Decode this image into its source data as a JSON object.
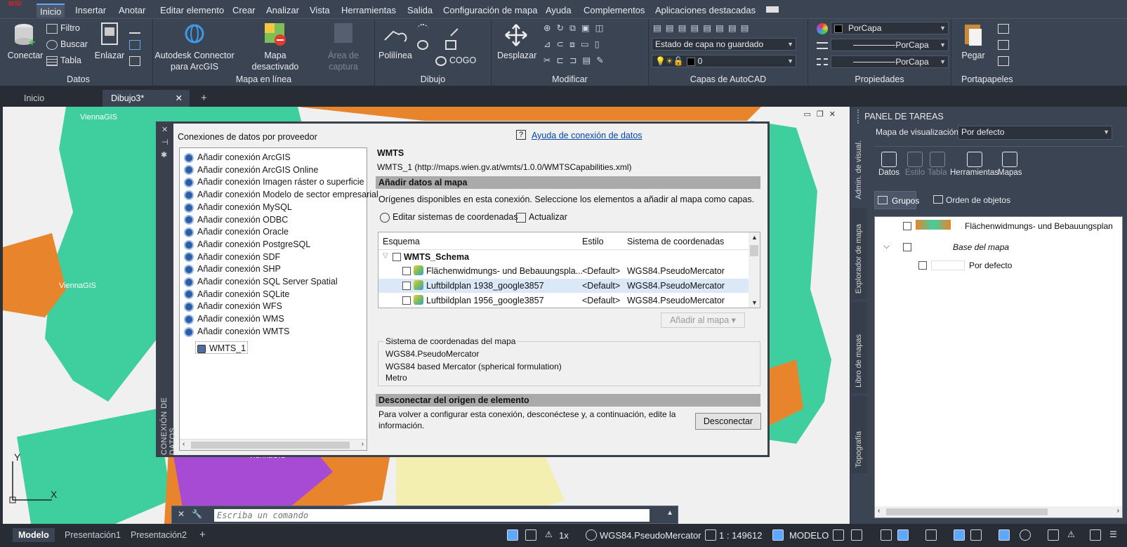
{
  "app": {
    "logo": "M3D"
  },
  "menu": [
    "Inicio",
    "Insertar",
    "Anotar",
    "Editar elemento",
    "Crear",
    "Analizar",
    "Vista",
    "Herramientas",
    "Salida",
    "Configuración de mapa",
    "Ayuda",
    "Complementos",
    "Aplicaciones destacadas"
  ],
  "ribbon": {
    "datos": {
      "title": "Datos",
      "conectar": "Conectar",
      "filtro": "Filtro",
      "buscar": "Buscar",
      "tabla": "Tabla"
    },
    "mapa_en_linea": {
      "title": "Mapa en línea",
      "enlazar": "Enlazar",
      "connector": "Autodesk Connector para ArcGIS",
      "connector_l1": "Autodesk Connector",
      "connector_l2": "para ArcGIS",
      "mapa_desactivado": "Mapa desactivado",
      "area_l1": "Área de",
      "area_l2": "captura"
    },
    "dibujo": {
      "title": "Dibujo",
      "polilinea": "Polilínea",
      "cogo": "COGO"
    },
    "modificar": {
      "title": "Modificar",
      "desplazar": "Desplazar"
    },
    "capas": {
      "title": "Capas de AutoCAD",
      "estado": "Estado de capa no guardado",
      "layer": "0"
    },
    "propiedades": {
      "title": "Propiedades",
      "color": "PorCapa",
      "linetype": "PorCapa",
      "lineweight": "PorCapa"
    },
    "portapapeles": {
      "title": "Portapapeles",
      "pegar": "Pegar"
    }
  },
  "tabs": {
    "inicio": "Inicio",
    "dibujo": "Dibujo3*",
    "add": "+"
  },
  "dialog": {
    "side_title": "CONEXIÓN DE DATOS",
    "providers_title": "Conexiones de datos por proveedor",
    "help_link": "Ayuda de conexión de datos",
    "providers": [
      "Añadir conexión ArcGIS",
      "Añadir conexión ArcGIS Online",
      "Añadir conexión Imagen ráster o superficie",
      "Añadir conexión Modelo de sector empresarial",
      "Añadir conexión MySQL",
      "Añadir conexión ODBC",
      "Añadir conexión Oracle",
      "Añadir conexión PostgreSQL",
      "Añadir conexión SDF",
      "Añadir conexión SHP",
      "Añadir conexión SQL Server Spatial",
      "Añadir conexión SQLite",
      "Añadir conexión WFS",
      "Añadir conexión WMS",
      "Añadir conexión WMTS"
    ],
    "child_connection": "WMTS_1",
    "conn_type": "WMTS",
    "conn_url": "WMTS_1 (http://maps.wien.gv.at/wmts/1.0.0/WMTSCapabilities.xml)",
    "add_data_header": "Añadir datos al mapa",
    "origins_text": "Orígenes disponibles en esta conexión. Seleccione los elementos a añadir al mapa como capas.",
    "edit_cs": "Editar sistemas de coordenadas",
    "refresh": "Actualizar",
    "columns": {
      "schema": "Esquema",
      "style": "Estilo",
      "cs": "Sistema de coordenadas"
    },
    "schema_name": "WMTS_Schema",
    "rows": [
      {
        "name": "Flächenwidmungs- und Bebauungspla...",
        "style": "<Default>",
        "cs": "WGS84.PseudoMercator"
      },
      {
        "name": "Luftbildplan 1938_google3857",
        "style": "<Default>",
        "cs": "WGS84.PseudoMercator"
      },
      {
        "name": "Luftbildplan 1956_google3857",
        "style": "<Default>",
        "cs": "WGS84.PseudoMercator"
      }
    ],
    "add_to_map": "Añadir al mapa",
    "map_cs_title": "Sistema de coordenadas del mapa",
    "map_cs_code": "WGS84.PseudoMercator",
    "map_cs_desc": "WGS84 based Mercator (spherical formulation)",
    "map_cs_unit": "Metro",
    "disconnect_header": "Desconectar del origen de elemento",
    "disconnect_text_1": "Para volver a configurar esta conexión, desconéctese y, a continuación, edite la",
    "disconnect_text_2": "información.",
    "disconnect_btn": "Desconectar"
  },
  "drawing": {
    "watermark": "ViennaGIS",
    "cmd_placeholder": "Escriba un comando",
    "axis_y": "Y",
    "axis_x": "X"
  },
  "taskpane": {
    "title": "PANEL DE TAREAS",
    "view_map_label": "Mapa de visualización:",
    "view_map_value": "Por defecto",
    "tools": [
      "Datos",
      "Estilo",
      "Tabla",
      "Herramientas",
      "Mapas"
    ],
    "groups_tab": "Grupos",
    "order_tab": "Orden de objetos",
    "layer1": "Flächenwidmungs- und Bebauungsplan",
    "group": "Base del mapa",
    "layer2": "Por defecto",
    "vtabs": [
      "Admin. de visual.",
      "Explorador de mapa",
      "Libro de mapas",
      "Topografía"
    ]
  },
  "status": {
    "model": "Modelo",
    "layout1": "Presentación1",
    "layout2": "Presentación2",
    "add": "+",
    "scale_ratio": "1x",
    "cs": "WGS84.PseudoMercator",
    "scale": "1 : 149612",
    "modelo": "MODELO"
  },
  "colors": {
    "accent": "#5fa8ff",
    "map_orange": "#e8842c",
    "map_green": "#3fcf9f",
    "map_purple": "#a84bd4"
  }
}
